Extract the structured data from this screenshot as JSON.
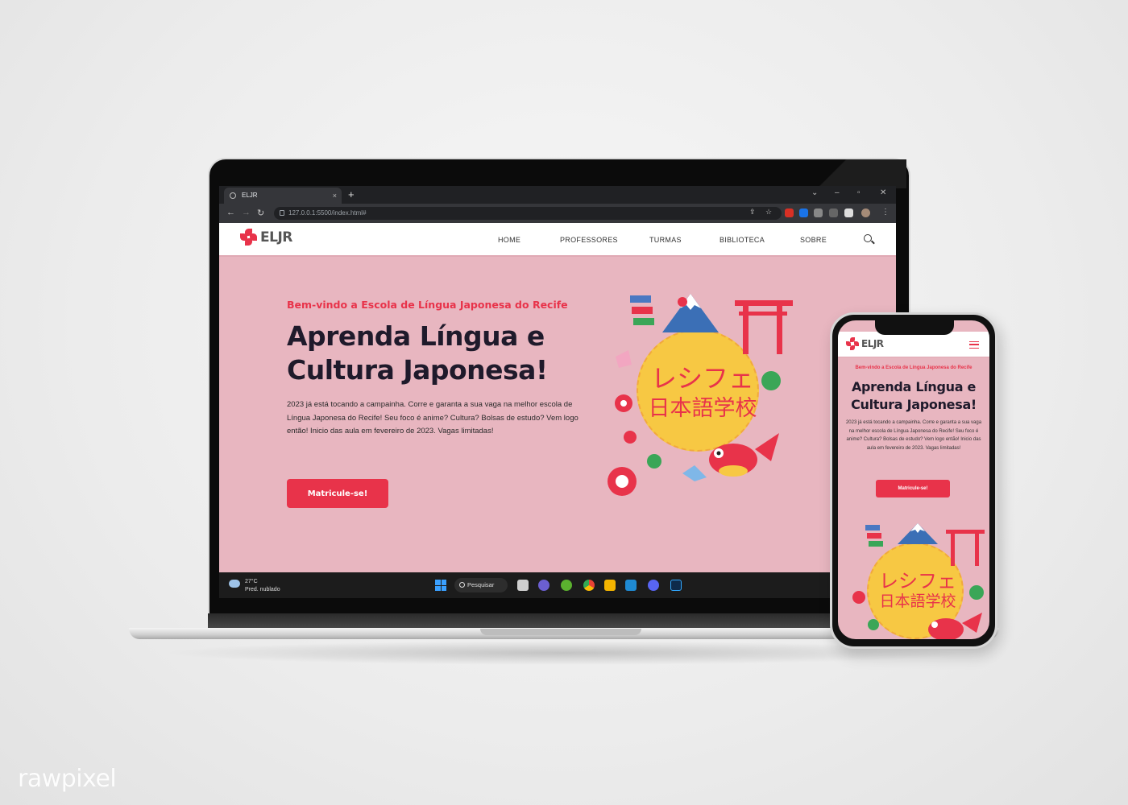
{
  "browser": {
    "tab_title": "ELJR",
    "new_tab": "+",
    "url": "127.0.0.1:5500/index.html#",
    "win_min": "–",
    "win_max": "▫",
    "win_close": "✕",
    "collapse": "⌄"
  },
  "site": {
    "logo_text": "ELJR",
    "nav": [
      "HOME",
      "PROFESSORES",
      "TURMAS",
      "BIBLIOTECA",
      "SOBRE"
    ],
    "hero_kicker": "Bem-vindo a Escola de Língua Japonesa do Recife",
    "hero_title": "Aprenda Língua e Cultura Japonesa!",
    "hero_text": "2023 já está tocando a campainha. Corre e garanta a sua vaga na melhor escola de Língua Japonesa do Recife! Seu foco é anime? Cultura? Bolsas de estudo? Vem logo então! Inicio das aula em fevereiro de 2023. Vagas limitadas!",
    "cta": "Matricule-se!",
    "illustration_line1": "レシフェ",
    "illustration_line2": "日本語学校"
  },
  "mobile": {
    "hero_text": "2023 já está tocando a campainha. Corre e garanta a sua vaga na melhor escola de Língua Japonesa do Recife! Seu foco é anime? Cultura? Bolsas de estudo? Vem logo então! Inicio das aula em fevereiro de 2023. Vagas limitadas!"
  },
  "taskbar": {
    "temperature": "27°C",
    "weather": "Pred. nublado",
    "search": "Pesquisar",
    "apps": [
      "file-explorer",
      "teams",
      "utorrent",
      "chrome",
      "folder",
      "vscode",
      "discord",
      "photoshop"
    ]
  },
  "colors": {
    "accent": "#e8334a",
    "hero_bg": "#e8b6c0",
    "title": "#1f1a2b"
  },
  "watermark": "rawpixel"
}
